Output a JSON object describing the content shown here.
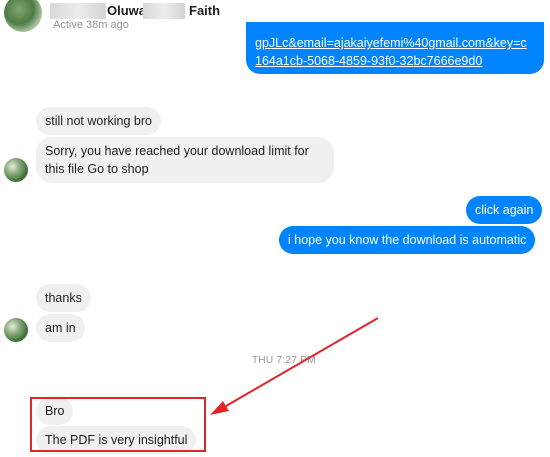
{
  "header": {
    "name_first": "Oluwa",
    "name_last": "Faith",
    "status": "Active 38m ago"
  },
  "messages": {
    "link_line1": "gpJLc&email=ajakaiyefemi%40gmail.com&key=c",
    "link_line2": "164a1cb-5068-4859-93f0-32bc7666e9d0",
    "m1": "still not working bro",
    "m2": "Sorry, you have reached your download limit for this file Go to shop",
    "m3": "click again",
    "m4": "i hope you know the download is automatic",
    "m5": "thanks",
    "m6": "am in",
    "m7": "Bro",
    "m8": "The PDF is very insightful"
  },
  "timestamp": "THU 7:27 PM",
  "colors": {
    "sent_bubble": "#0084ff",
    "received_bubble": "#f1f0f0",
    "highlight": "#e0262a"
  }
}
